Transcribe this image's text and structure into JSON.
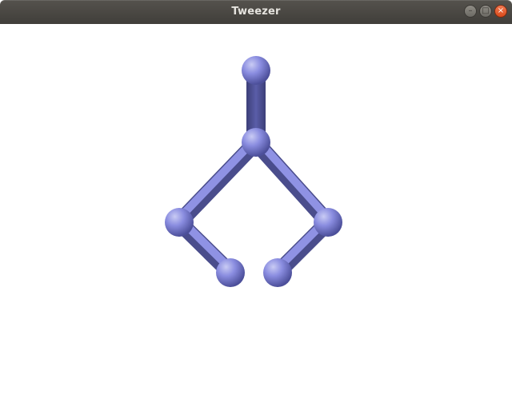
{
  "window": {
    "title": "Tweezer",
    "controls": {
      "minimize_icon": "minimize-icon",
      "maximize_icon": "maximize-icon",
      "close_icon": "close-icon"
    }
  },
  "scene": {
    "object": "tweezer",
    "colors": {
      "body": "#7b7fd6",
      "shadow": "#4a4d8c",
      "highlight": "#c9cbf4",
      "background": "#ffffff"
    }
  }
}
